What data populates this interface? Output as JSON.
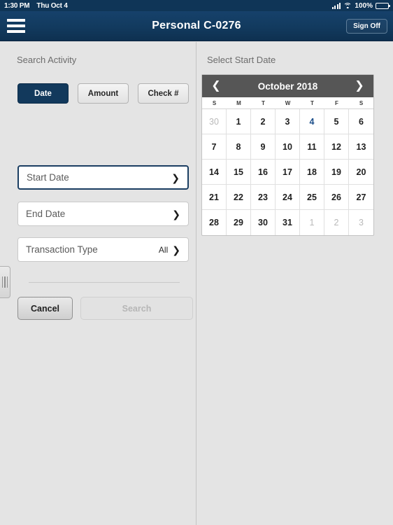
{
  "status_bar": {
    "time": "1:30 PM",
    "date": "Thu Oct 4",
    "battery_percent": "100%",
    "signal_icon": "cellular-signal-icon",
    "wifi_icon": "wifi-icon",
    "battery_icon": "battery-full-icon"
  },
  "navbar": {
    "menu_icon": "hamburger-menu-icon",
    "title": "Personal C-0276",
    "sign_off_label": "Sign Off"
  },
  "left_panel": {
    "heading": "Search Activity",
    "search_type_buttons": [
      {
        "label": "Date",
        "active": true
      },
      {
        "label": "Amount",
        "active": false
      },
      {
        "label": "Check #",
        "active": false
      }
    ],
    "fields": [
      {
        "label": "Start Date",
        "value": "",
        "focused": true,
        "chevron": "chevron-right-icon"
      },
      {
        "label": "End Date",
        "value": "",
        "focused": false,
        "chevron": "chevron-right-icon"
      },
      {
        "label": "Transaction Type",
        "value": "All",
        "focused": false,
        "chevron": "chevron-right-icon"
      }
    ],
    "cancel_label": "Cancel",
    "search_label": "Search",
    "search_enabled": false,
    "drag_handle_icon": "drag-handle-icon"
  },
  "right_panel": {
    "heading": "Select Start Date",
    "calendar": {
      "prev_icon": "chevron-left-icon",
      "next_icon": "chevron-right-icon",
      "title": "October 2018",
      "weekdays": [
        "S",
        "M",
        "T",
        "W",
        "T",
        "F",
        "S"
      ],
      "weeks": [
        [
          {
            "day": "30",
            "muted": true,
            "today": false
          },
          {
            "day": "1",
            "muted": false,
            "today": false
          },
          {
            "day": "2",
            "muted": false,
            "today": false
          },
          {
            "day": "3",
            "muted": false,
            "today": false
          },
          {
            "day": "4",
            "muted": false,
            "today": true
          },
          {
            "day": "5",
            "muted": false,
            "today": false
          },
          {
            "day": "6",
            "muted": false,
            "today": false
          }
        ],
        [
          {
            "day": "7",
            "muted": false,
            "today": false
          },
          {
            "day": "8",
            "muted": false,
            "today": false
          },
          {
            "day": "9",
            "muted": false,
            "today": false
          },
          {
            "day": "10",
            "muted": false,
            "today": false
          },
          {
            "day": "11",
            "muted": false,
            "today": false
          },
          {
            "day": "12",
            "muted": false,
            "today": false
          },
          {
            "day": "13",
            "muted": false,
            "today": false
          }
        ],
        [
          {
            "day": "14",
            "muted": false,
            "today": false
          },
          {
            "day": "15",
            "muted": false,
            "today": false
          },
          {
            "day": "16",
            "muted": false,
            "today": false
          },
          {
            "day": "17",
            "muted": false,
            "today": false
          },
          {
            "day": "18",
            "muted": false,
            "today": false
          },
          {
            "day": "19",
            "muted": false,
            "today": false
          },
          {
            "day": "20",
            "muted": false,
            "today": false
          }
        ],
        [
          {
            "day": "21",
            "muted": false,
            "today": false
          },
          {
            "day": "22",
            "muted": false,
            "today": false
          },
          {
            "day": "23",
            "muted": false,
            "today": false
          },
          {
            "day": "24",
            "muted": false,
            "today": false
          },
          {
            "day": "25",
            "muted": false,
            "today": false
          },
          {
            "day": "26",
            "muted": false,
            "today": false
          },
          {
            "day": "27",
            "muted": false,
            "today": false
          }
        ],
        [
          {
            "day": "28",
            "muted": false,
            "today": false
          },
          {
            "day": "29",
            "muted": false,
            "today": false
          },
          {
            "day": "30",
            "muted": false,
            "today": false
          },
          {
            "day": "31",
            "muted": false,
            "today": false
          },
          {
            "day": "1",
            "muted": true,
            "today": false
          },
          {
            "day": "2",
            "muted": true,
            "today": false
          },
          {
            "day": "3",
            "muted": true,
            "today": false
          }
        ]
      ]
    }
  },
  "colors": {
    "navy": "#123a5e",
    "panel_bg": "#e4e4e4",
    "calendar_header": "#565656",
    "today_blue": "#1b4e8a"
  }
}
